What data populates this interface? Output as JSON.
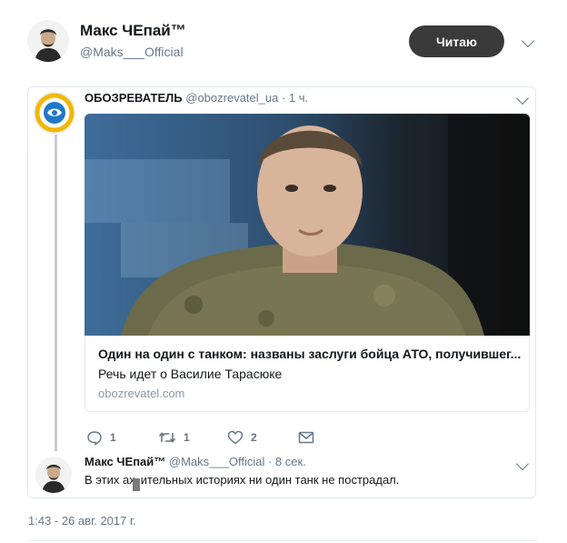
{
  "author": {
    "name": "Макс ЧЕпай™",
    "handle": "@Maks___Official"
  },
  "follow_button": {
    "label": "Читаю"
  },
  "quoted_tweet": {
    "source_name": "ОБОЗРЕВАТЕЛЬ",
    "source_meta": "@obozrevatel_ua · 1 ч.",
    "link": {
      "title": "Один на один с танком: названы заслуги бойца АТО, получившег...",
      "description": "Речь идет о Василие Тарасюке",
      "domain": "obozrevatel.com"
    },
    "actions": {
      "reply_count": "1",
      "retweet_count": "1",
      "like_count": "2"
    }
  },
  "reply": {
    "name": "Макс ЧЕпай™",
    "meta": "@Maks___Official · 8 сек.",
    "text_before": "В этих ах",
    "text_after": "ительных историях ни один танк не пострадал."
  },
  "timestamp": "1:43 - 26 авг. 2017 г.",
  "icons": {
    "header_more": "chevron-down-icon",
    "quote_more": "chevron-down-icon",
    "reply_more": "chevron-down-icon",
    "reply": "reply-icon",
    "retweet": "retweet-icon",
    "like": "heart-icon",
    "message": "envelope-icon"
  },
  "colors": {
    "follow_button_bg": "#3a3a3a",
    "muted_text": "#657786",
    "border": "#e1e8ed"
  }
}
